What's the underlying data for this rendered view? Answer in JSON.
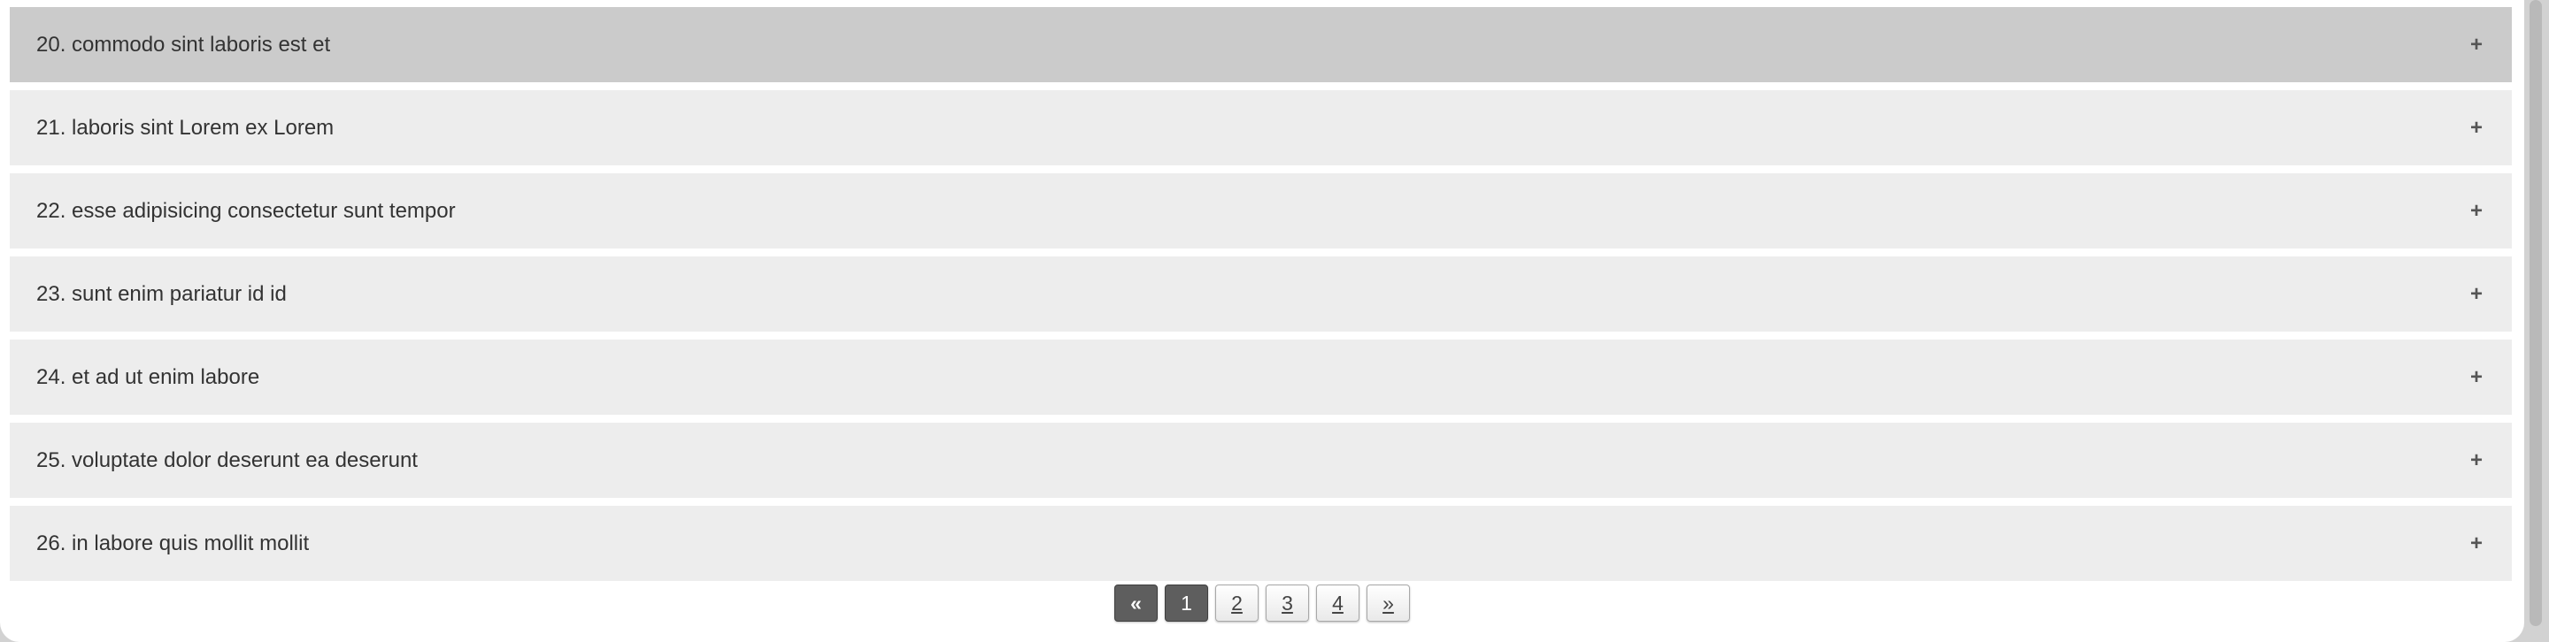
{
  "accordion": {
    "items": [
      {
        "title": "20. commodo sint laboris est et",
        "toggle": "+"
      },
      {
        "title": "21. laboris sint Lorem ex Lorem",
        "toggle": "+"
      },
      {
        "title": "22. esse adipisicing consectetur sunt tempor",
        "toggle": "+"
      },
      {
        "title": "23. sunt enim pariatur id id",
        "toggle": "+"
      },
      {
        "title": "24. et ad ut enim labore",
        "toggle": "+"
      },
      {
        "title": "25. voluptate dolor deserunt ea deserunt",
        "toggle": "+"
      },
      {
        "title": "26. in labore quis mollit mollit",
        "toggle": "+"
      }
    ]
  },
  "pagination": {
    "prev": "«",
    "pages": [
      "1",
      "2",
      "3",
      "4"
    ],
    "current_page": "1",
    "next": "»"
  }
}
